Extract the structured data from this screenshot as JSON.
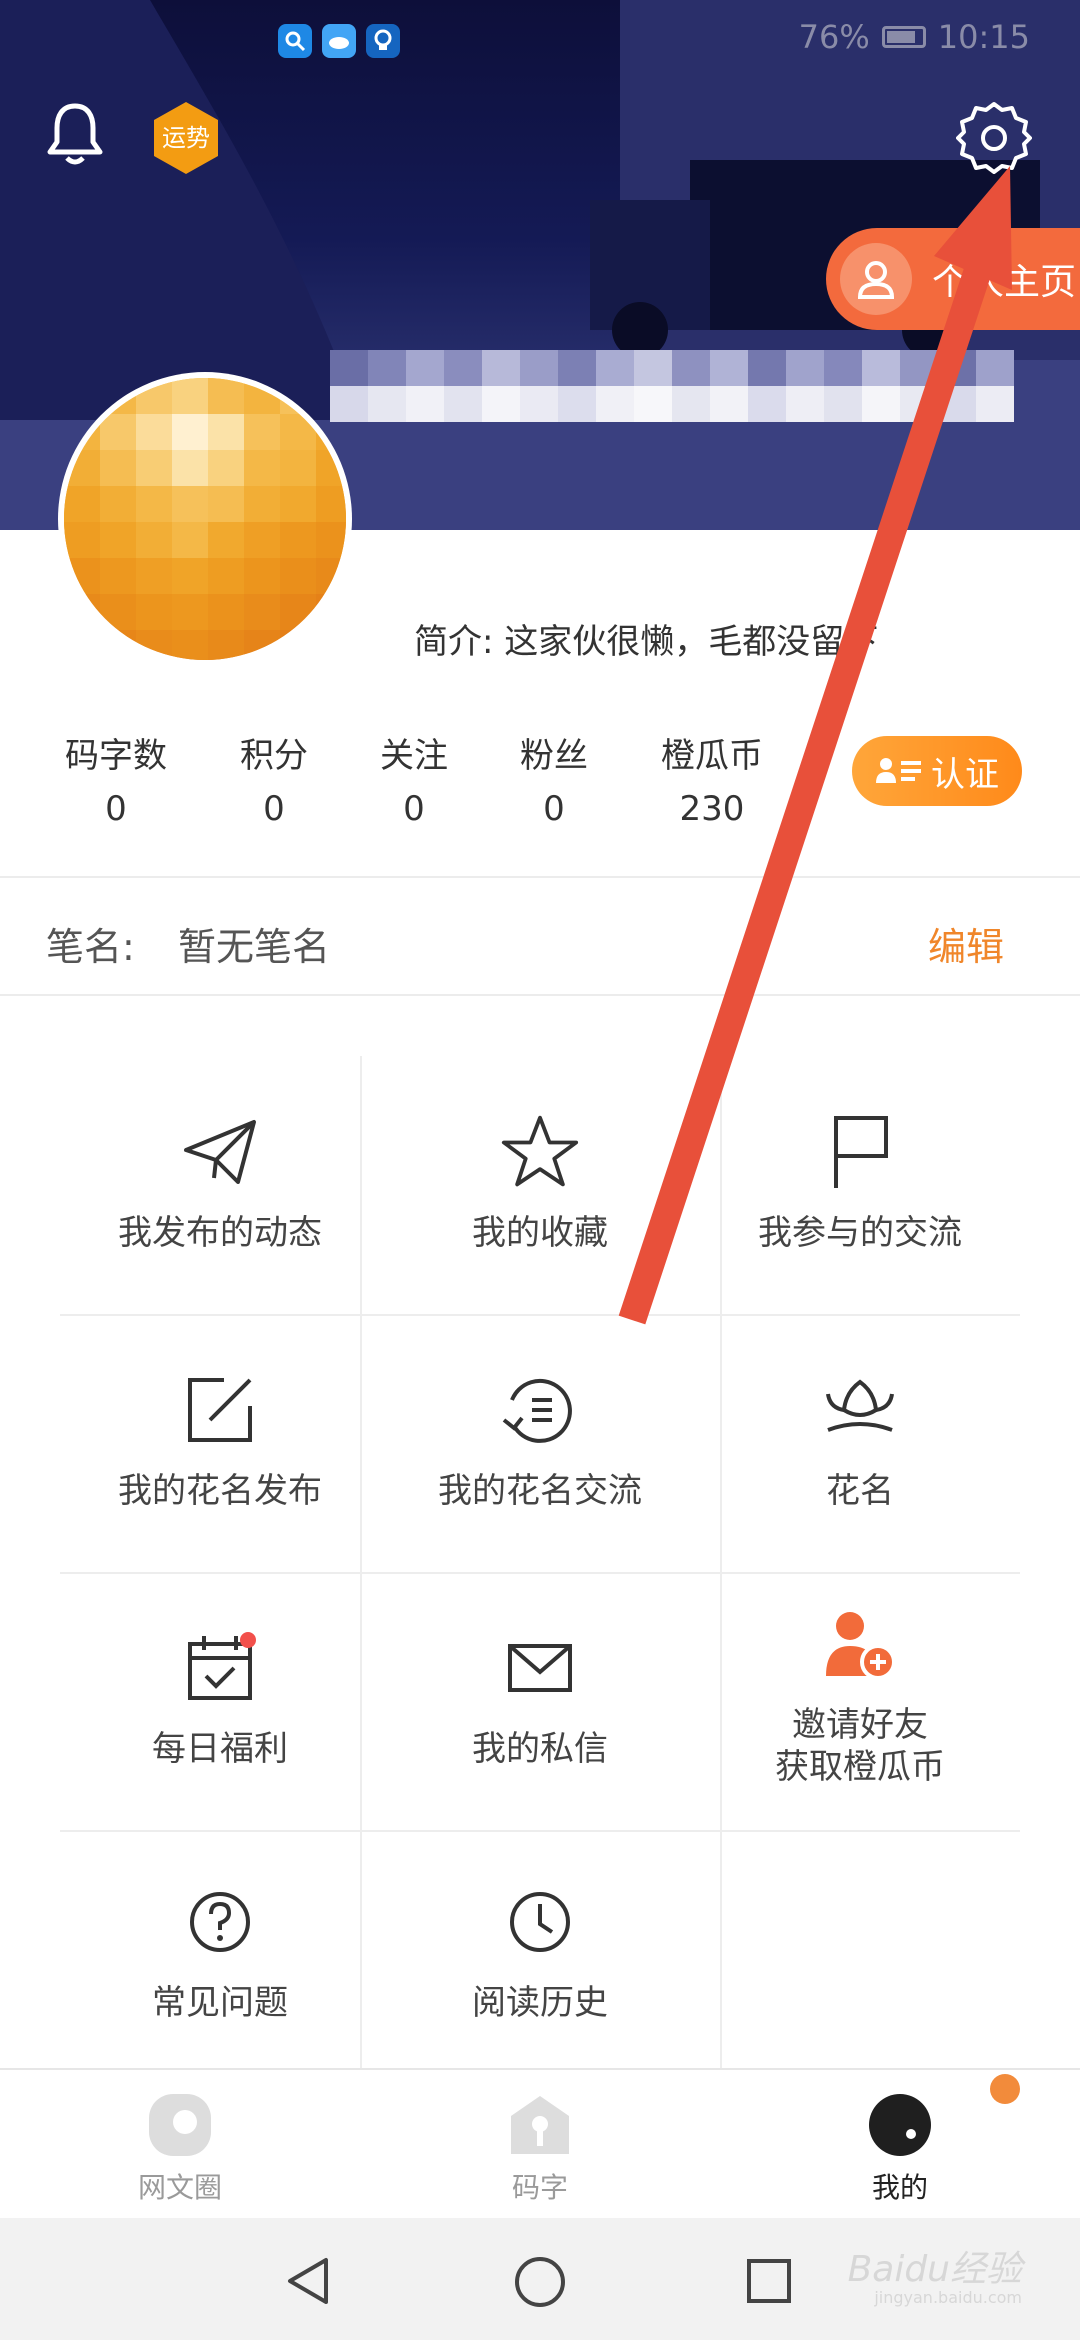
{
  "status_bar": {
    "battery": "76%",
    "time": "10:15"
  },
  "header": {
    "fortune_badge": "运势",
    "profile_button": "个人主页"
  },
  "profile": {
    "intro_prefix": "简介:",
    "intro_text": "这家伙很懒，毛都没留下"
  },
  "stats": [
    {
      "label": "码字数",
      "value": "0"
    },
    {
      "label": "积分",
      "value": "0"
    },
    {
      "label": "关注",
      "value": "0"
    },
    {
      "label": "粉丝",
      "value": "0"
    },
    {
      "label": "橙瓜币",
      "value": "230"
    }
  ],
  "cert_button": "认证",
  "pen_name": {
    "label": "笔名:",
    "value": "暂无笔名",
    "edit": "编辑"
  },
  "grid": [
    {
      "label": "我发布的动态",
      "icon": "paper-plane-icon"
    },
    {
      "label": "我的收藏",
      "icon": "star-icon"
    },
    {
      "label": "我参与的交流",
      "icon": "flag-icon"
    },
    {
      "label": "我的花名发布",
      "icon": "edit-square-icon"
    },
    {
      "label": "我的花名交流",
      "icon": "chat-history-icon"
    },
    {
      "label": "花名",
      "icon": "lotus-icon"
    },
    {
      "label": "每日福利",
      "icon": "calendar-check-icon"
    },
    {
      "label": "我的私信",
      "icon": "envelope-icon"
    },
    {
      "label": "邀请好友",
      "label2": "获取橙瓜币",
      "icon": "add-user-icon"
    },
    {
      "label": "常见问题",
      "icon": "question-icon"
    },
    {
      "label": "阅读历史",
      "icon": "clock-icon"
    }
  ],
  "tabs": [
    {
      "label": "网文圈",
      "icon": "circle-tab-icon"
    },
    {
      "label": "码字",
      "icon": "house-pen-icon"
    },
    {
      "label": "我的",
      "icon": "profile-dot-icon"
    }
  ],
  "watermark": {
    "text": "Baidu经验",
    "sub": "jingyan.baidu.com"
  },
  "colors": {
    "accent_orange": "#f0862a",
    "profile_button": "#f36a3d",
    "arrow_red": "#e8503a",
    "badge_red": "#f2504b"
  }
}
